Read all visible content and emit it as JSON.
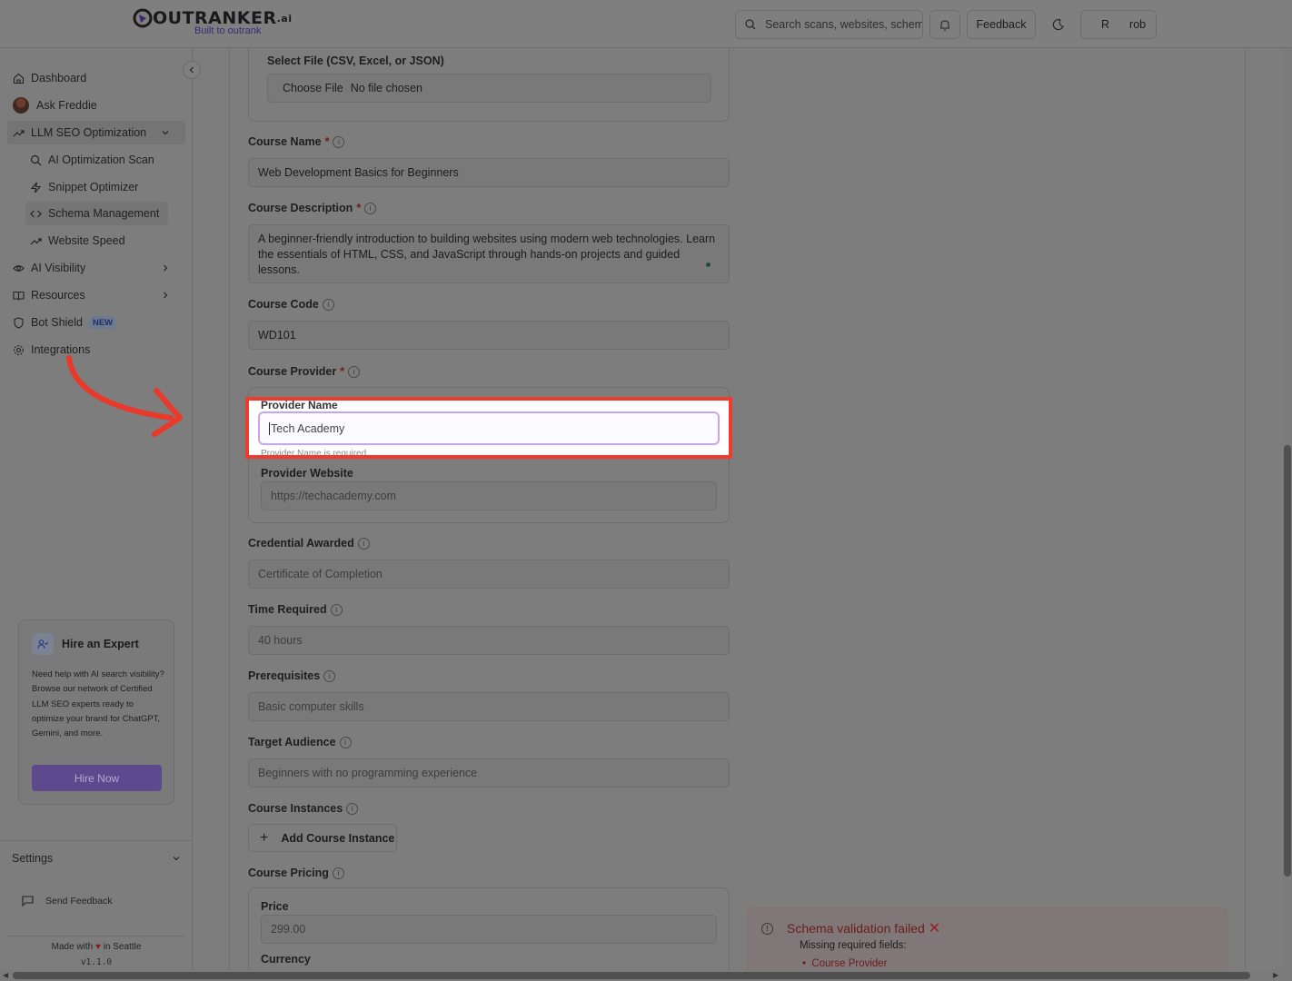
{
  "header": {
    "logo_text": "OUTRANKER",
    "logo_suffix": ".ai",
    "logo_sub": "Built to outrank",
    "search_placeholder": "Search scans, websites, schemas",
    "feedback_label": "Feedback",
    "user_initial": "R",
    "user_name": "rob"
  },
  "sidebar": {
    "items": {
      "dashboard": "Dashboard",
      "ask_freddie": "Ask Freddie",
      "llm_seo": "LLM SEO Optimization",
      "ai_scan": "AI Optimization Scan",
      "snippet": "Snippet Optimizer",
      "schema": "Schema Management",
      "speed": "Website Speed",
      "visibility": "AI Visibility",
      "resources": "Resources",
      "bot_shield": "Bot Shield",
      "bot_shield_badge": "NEW",
      "integrations": "Integrations"
    },
    "expert": {
      "title": "Hire an Expert",
      "text": "Need help with AI search visibility? Browse our network of Certified LLM SEO experts ready to optimize your brand for ChatGPT, Gemini, and more.",
      "button": "Hire Now"
    },
    "settings": "Settings",
    "send_feedback": "Send Feedback",
    "made_with_prefix": "Made with",
    "made_with_suffix": "in Seattle",
    "version": "v1.1.0"
  },
  "form": {
    "file_label": "Select File (CSV, Excel, or JSON)",
    "file_button": "Choose File",
    "file_status": "No file chosen",
    "course_name_label": "Course Name",
    "course_name_value": "Web Development Basics for Beginners",
    "course_desc_label": "Course Description",
    "course_desc_value": "A beginner-friendly introduction to building websites using modern web technologies. Learn the essentials of HTML, CSS, and JavaScript through hands-on projects and guided lessons.",
    "course_code_label": "Course Code",
    "course_code_value": "WD101",
    "provider_label": "Course Provider",
    "provider_name_label": "Provider Name",
    "provider_name_placeholder": "Tech Academy",
    "provider_help": "Provider Name is required",
    "provider_website_label": "Provider Website",
    "provider_website_placeholder": "https://techacademy.com",
    "credential_label": "Credential Awarded",
    "credential_placeholder": "Certificate of Completion",
    "time_label": "Time Required",
    "time_placeholder": "40 hours",
    "prereq_label": "Prerequisites",
    "prereq_placeholder": "Basic computer skills",
    "audience_label": "Target Audience",
    "audience_placeholder": "Beginners with no programming experience",
    "instances_label": "Course Instances",
    "add_instance": "Add Course Instance",
    "pricing_label": "Course Pricing",
    "price_label": "Price",
    "price_placeholder": "299.00",
    "currency_label": "Currency"
  },
  "toast": {
    "title": "Schema validation failed",
    "subtitle": "Missing required fields:",
    "missing_item": "Course Provider"
  }
}
